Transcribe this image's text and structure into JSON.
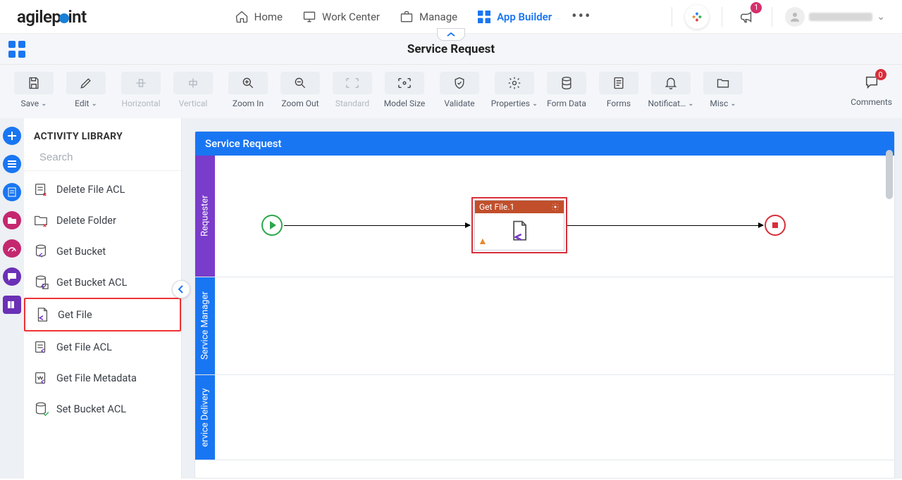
{
  "brand": "agilepoint",
  "nav": {
    "home": "Home",
    "work_center": "Work Center",
    "manage": "Manage",
    "app_builder": "App Builder"
  },
  "badges": {
    "announcement": "1",
    "comments": "0"
  },
  "page_title": "Service Request",
  "toolbar": {
    "save": "Save",
    "edit": "Edit",
    "horizontal": "Horizontal",
    "vertical": "Vertical",
    "zoom_in": "Zoom In",
    "zoom_out": "Zoom Out",
    "standard": "Standard",
    "model_size": "Model Size",
    "validate": "Validate",
    "properties": "Properties",
    "form_data": "Form Data",
    "forms": "Forms",
    "notifications": "Notificat…",
    "misc": "Misc",
    "comments": "Comments"
  },
  "sidebar": {
    "title": "ACTIVITY LIBRARY",
    "search_placeholder": "Search",
    "items": [
      "Delete File ACL",
      "Delete Folder",
      "Get Bucket",
      "Get Bucket ACL",
      "Get File",
      "Get File ACL",
      "Get File Metadata",
      "Set Bucket ACL"
    ]
  },
  "canvas": {
    "header": "Service Request",
    "lanes": [
      "Requester",
      "Service Manager",
      "ervice Delivery"
    ],
    "activity_label": "Get File.1"
  }
}
